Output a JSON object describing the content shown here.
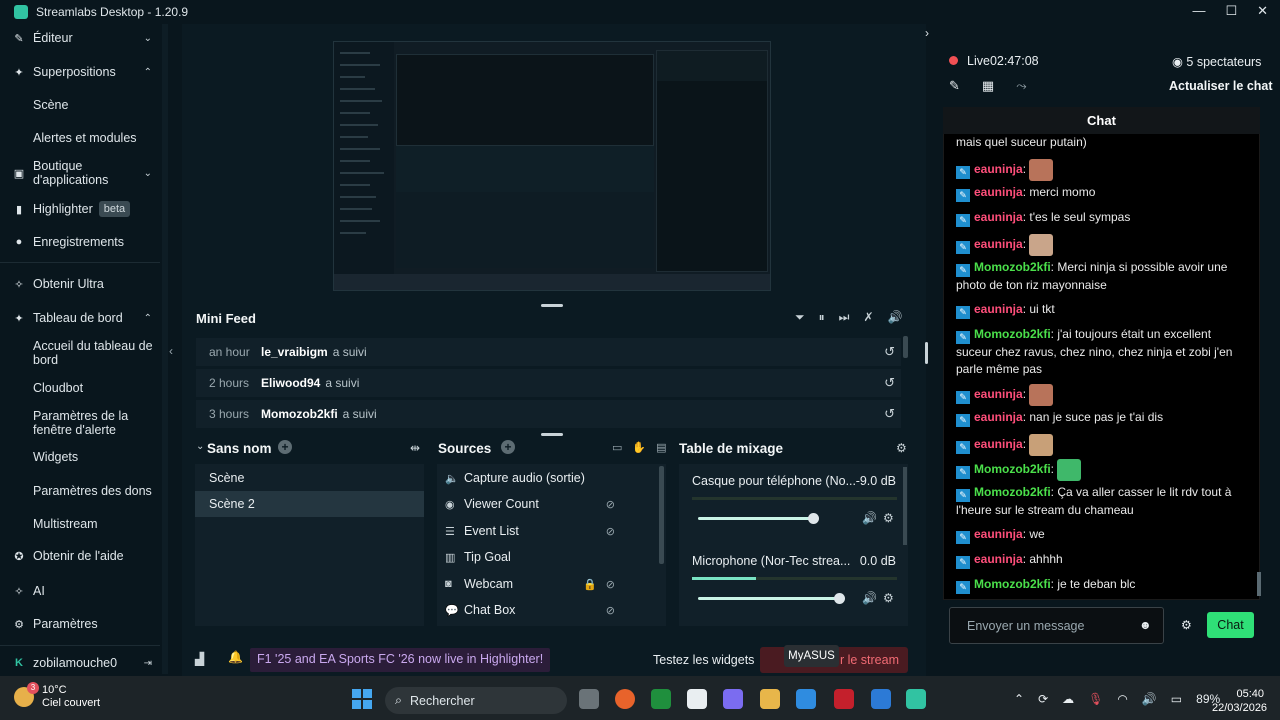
{
  "window": {
    "title": "Streamlabs Desktop - 1.20.9"
  },
  "sidebar": {
    "items": [
      {
        "label": "Éditeur",
        "icon": "pencil-icon",
        "chevron": "⌄"
      },
      {
        "label": "Superpositions",
        "icon": "overlay-icon",
        "chevron": "⌃"
      },
      {
        "label": "Boutique d'applications",
        "icon": "store-icon",
        "chevron": "⌄"
      },
      {
        "label": "Highlighter",
        "icon": "highlighter-icon",
        "badge": "beta"
      },
      {
        "label": "Enregistrements",
        "icon": "record-icon"
      },
      {
        "label": "Obtenir Ultra",
        "icon": "ultra-icon"
      },
      {
        "label": "Tableau de bord",
        "icon": "dashboard-icon",
        "chevron": "⌃"
      },
      {
        "label": "Obtenir de l'aide",
        "icon": "help-icon"
      },
      {
        "label": "AI",
        "icon": "ai-icon"
      },
      {
        "label": "Paramètres",
        "icon": "gear-icon"
      }
    ],
    "overlay_sub": [
      "Scène",
      "Alertes et modules"
    ],
    "dashboard_sub": [
      "Accueil du tableau de bord",
      "Cloudbot",
      "Paramètres de la fenêtre d'alerte",
      "Widgets",
      "Paramètres des dons",
      "Multistream"
    ],
    "user": "zobilamouche0"
  },
  "minifeed": {
    "title": "Mini Feed",
    "rows": [
      {
        "time": "an hour",
        "user": "le_vraibigm",
        "action": "a suivi"
      },
      {
        "time": "2 hours",
        "user": "Eliwood94",
        "action": "a suivi"
      },
      {
        "time": "3 hours",
        "user": "Momozob2kfi",
        "action": "a suivi"
      }
    ]
  },
  "scenes": {
    "title": "Sans nom",
    "items": [
      "Scène",
      "Scène 2"
    ],
    "active": 1
  },
  "sources": {
    "title": "Sources",
    "items": [
      {
        "label": "Capture audio (sortie)",
        "icon": "speaker-icon"
      },
      {
        "label": "Viewer Count",
        "icon": "eye-icon"
      },
      {
        "label": "Event List",
        "icon": "list-icon"
      },
      {
        "label": "Tip Goal",
        "icon": "goal-icon"
      },
      {
        "label": "Webcam",
        "icon": "camera-icon"
      },
      {
        "label": "Chat Box",
        "icon": "chat-icon"
      }
    ]
  },
  "mixer": {
    "title": "Table de mixage",
    "channels": [
      {
        "name": "Casque pour téléphone (No...",
        "db": "-9.0 dB",
        "level": 0.82
      },
      {
        "name": "Microphone (Nor-Tec strea...",
        "db": "0.0 dB",
        "level": 1.0
      }
    ]
  },
  "status": {
    "banner": "F1 '25 and EA Sports FC '26 now live in Highlighter!",
    "test_widgets": "Testez les widgets",
    "golive": "r le stream",
    "tooltip": "MyASUS"
  },
  "live": {
    "status": "Live",
    "timer": "02:47:08",
    "viewers": "5 spectateurs",
    "refresh": "Actualiser le chat"
  },
  "chat": {
    "header": "Chat",
    "messages": [
      {
        "user": "",
        "text": "mais quel suceur putain)"
      },
      {
        "user": "eauninja",
        "text": "",
        "emote": true,
        "color": "n1"
      },
      {
        "user": "eauninja",
        "text": "merci momo",
        "color": "n1"
      },
      {
        "user": "eauninja",
        "text": "t'es le seul sympas",
        "color": "n1"
      },
      {
        "user": "eauninja",
        "text": "",
        "emote": true,
        "color": "n1"
      },
      {
        "user": "Momozob2kfi",
        "text": "Merci ninja si possible avoir une photo de ton riz mayonnaise",
        "color": "n2"
      },
      {
        "user": "eauninja",
        "text": "ui tkt",
        "color": "n1"
      },
      {
        "user": "Momozob2kfi",
        "text": "j'ai toujours était un excellent suceur chez ravus, chez nino, chez ninja et zobi j'en parle même pas",
        "color": "n2"
      },
      {
        "user": "eauninja",
        "text": "",
        "emote": true,
        "color": "n1"
      },
      {
        "user": "eauninja",
        "text": "nan je suce pas je t'ai dis",
        "color": "n1"
      },
      {
        "user": "eauninja",
        "text": "",
        "emote": true,
        "color": "n1"
      },
      {
        "user": "Momozob2kfi",
        "text": "",
        "emote": true,
        "color": "n2"
      },
      {
        "user": "Momozob2kfi",
        "text": "Ça va aller casser le lit rdv tout à l'heure sur le stream du chameau",
        "color": "n2"
      },
      {
        "user": "eauninja",
        "text": "we",
        "color": "n1"
      },
      {
        "user": "eauninja",
        "text": "ahhhh",
        "color": "n1"
      },
      {
        "user": "Momozob2kfi",
        "text": "je te deban blc",
        "color": "n2"
      }
    ],
    "input_placeholder": "Envoyer un message",
    "send": "Chat"
  },
  "taskbar": {
    "temp": "10°C",
    "weather": "Ciel couvert",
    "weather_badge": "3",
    "search": "Rechercher",
    "battery": "89%",
    "time": "05:40",
    "date": "22/03/2026"
  },
  "colors": {
    "accent": "#31c3a2",
    "live": "#f15054",
    "chat_send": "#2fe077"
  }
}
